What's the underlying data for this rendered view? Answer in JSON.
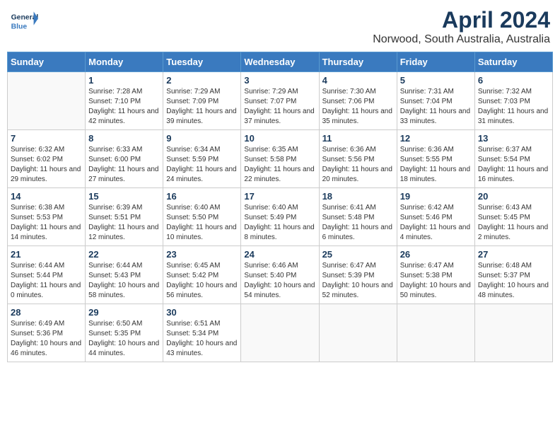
{
  "header": {
    "logo_general": "General",
    "logo_blue": "Blue",
    "month_title": "April 2024",
    "location": "Norwood, South Australia, Australia"
  },
  "weekdays": [
    "Sunday",
    "Monday",
    "Tuesday",
    "Wednesday",
    "Thursday",
    "Friday",
    "Saturday"
  ],
  "weeks": [
    [
      {
        "day": "",
        "info": ""
      },
      {
        "day": "1",
        "info": "Sunrise: 7:28 AM\nSunset: 7:10 PM\nDaylight: 11 hours\nand 42 minutes."
      },
      {
        "day": "2",
        "info": "Sunrise: 7:29 AM\nSunset: 7:09 PM\nDaylight: 11 hours\nand 39 minutes."
      },
      {
        "day": "3",
        "info": "Sunrise: 7:29 AM\nSunset: 7:07 PM\nDaylight: 11 hours\nand 37 minutes."
      },
      {
        "day": "4",
        "info": "Sunrise: 7:30 AM\nSunset: 7:06 PM\nDaylight: 11 hours\nand 35 minutes."
      },
      {
        "day": "5",
        "info": "Sunrise: 7:31 AM\nSunset: 7:04 PM\nDaylight: 11 hours\nand 33 minutes."
      },
      {
        "day": "6",
        "info": "Sunrise: 7:32 AM\nSunset: 7:03 PM\nDaylight: 11 hours\nand 31 minutes."
      }
    ],
    [
      {
        "day": "7",
        "info": "Sunrise: 6:32 AM\nSunset: 6:02 PM\nDaylight: 11 hours\nand 29 minutes."
      },
      {
        "day": "8",
        "info": "Sunrise: 6:33 AM\nSunset: 6:00 PM\nDaylight: 11 hours\nand 27 minutes."
      },
      {
        "day": "9",
        "info": "Sunrise: 6:34 AM\nSunset: 5:59 PM\nDaylight: 11 hours\nand 24 minutes."
      },
      {
        "day": "10",
        "info": "Sunrise: 6:35 AM\nSunset: 5:58 PM\nDaylight: 11 hours\nand 22 minutes."
      },
      {
        "day": "11",
        "info": "Sunrise: 6:36 AM\nSunset: 5:56 PM\nDaylight: 11 hours\nand 20 minutes."
      },
      {
        "day": "12",
        "info": "Sunrise: 6:36 AM\nSunset: 5:55 PM\nDaylight: 11 hours\nand 18 minutes."
      },
      {
        "day": "13",
        "info": "Sunrise: 6:37 AM\nSunset: 5:54 PM\nDaylight: 11 hours\nand 16 minutes."
      }
    ],
    [
      {
        "day": "14",
        "info": "Sunrise: 6:38 AM\nSunset: 5:53 PM\nDaylight: 11 hours\nand 14 minutes."
      },
      {
        "day": "15",
        "info": "Sunrise: 6:39 AM\nSunset: 5:51 PM\nDaylight: 11 hours\nand 12 minutes."
      },
      {
        "day": "16",
        "info": "Sunrise: 6:40 AM\nSunset: 5:50 PM\nDaylight: 11 hours\nand 10 minutes."
      },
      {
        "day": "17",
        "info": "Sunrise: 6:40 AM\nSunset: 5:49 PM\nDaylight: 11 hours\nand 8 minutes."
      },
      {
        "day": "18",
        "info": "Sunrise: 6:41 AM\nSunset: 5:48 PM\nDaylight: 11 hours\nand 6 minutes."
      },
      {
        "day": "19",
        "info": "Sunrise: 6:42 AM\nSunset: 5:46 PM\nDaylight: 11 hours\nand 4 minutes."
      },
      {
        "day": "20",
        "info": "Sunrise: 6:43 AM\nSunset: 5:45 PM\nDaylight: 11 hours\nand 2 minutes."
      }
    ],
    [
      {
        "day": "21",
        "info": "Sunrise: 6:44 AM\nSunset: 5:44 PM\nDaylight: 11 hours\nand 0 minutes."
      },
      {
        "day": "22",
        "info": "Sunrise: 6:44 AM\nSunset: 5:43 PM\nDaylight: 10 hours\nand 58 minutes."
      },
      {
        "day": "23",
        "info": "Sunrise: 6:45 AM\nSunset: 5:42 PM\nDaylight: 10 hours\nand 56 minutes."
      },
      {
        "day": "24",
        "info": "Sunrise: 6:46 AM\nSunset: 5:40 PM\nDaylight: 10 hours\nand 54 minutes."
      },
      {
        "day": "25",
        "info": "Sunrise: 6:47 AM\nSunset: 5:39 PM\nDaylight: 10 hours\nand 52 minutes."
      },
      {
        "day": "26",
        "info": "Sunrise: 6:47 AM\nSunset: 5:38 PM\nDaylight: 10 hours\nand 50 minutes."
      },
      {
        "day": "27",
        "info": "Sunrise: 6:48 AM\nSunset: 5:37 PM\nDaylight: 10 hours\nand 48 minutes."
      }
    ],
    [
      {
        "day": "28",
        "info": "Sunrise: 6:49 AM\nSunset: 5:36 PM\nDaylight: 10 hours\nand 46 minutes."
      },
      {
        "day": "29",
        "info": "Sunrise: 6:50 AM\nSunset: 5:35 PM\nDaylight: 10 hours\nand 44 minutes."
      },
      {
        "day": "30",
        "info": "Sunrise: 6:51 AM\nSunset: 5:34 PM\nDaylight: 10 hours\nand 43 minutes."
      },
      {
        "day": "",
        "info": ""
      },
      {
        "day": "",
        "info": ""
      },
      {
        "day": "",
        "info": ""
      },
      {
        "day": "",
        "info": ""
      }
    ]
  ]
}
